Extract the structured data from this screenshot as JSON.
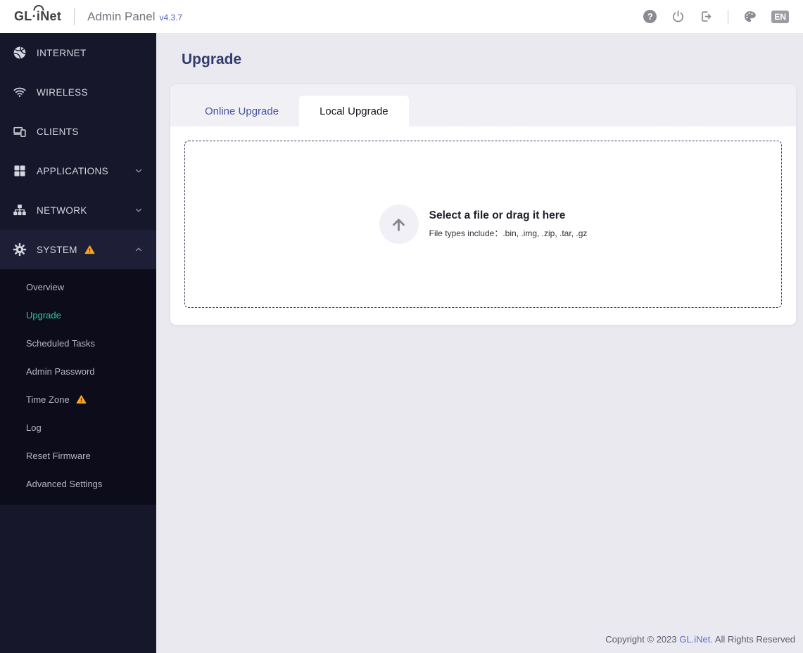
{
  "header": {
    "logo_prefix": "GL·",
    "logo_i": "i",
    "logo_suffix": "Net",
    "title": "Admin Panel",
    "version": "v4.3.7",
    "help_glyph": "?",
    "language": "EN",
    "icons": [
      "help-icon",
      "power-icon",
      "logout-icon",
      "theme-palette-icon"
    ]
  },
  "sidebar": {
    "items": [
      {
        "label": "INTERNET",
        "icon": "globe-icon"
      },
      {
        "label": "WIRELESS",
        "icon": "wifi-icon"
      },
      {
        "label": "CLIENTS",
        "icon": "devices-icon"
      },
      {
        "label": "APPLICATIONS",
        "icon": "apps-grid-icon",
        "chevron": "down"
      },
      {
        "label": "NETWORK",
        "icon": "network-icon",
        "chevron": "down"
      },
      {
        "label": "SYSTEM",
        "icon": "gear-icon",
        "chevron": "up",
        "warning": true,
        "expanded": true
      }
    ],
    "system_submenu": [
      {
        "label": "Overview",
        "active": false,
        "warning": false
      },
      {
        "label": "Upgrade",
        "active": true,
        "warning": false
      },
      {
        "label": "Scheduled Tasks",
        "active": false,
        "warning": false
      },
      {
        "label": "Admin Password",
        "active": false,
        "warning": false
      },
      {
        "label": "Time Zone",
        "active": false,
        "warning": true
      },
      {
        "label": "Log",
        "active": false,
        "warning": false
      },
      {
        "label": "Reset Firmware",
        "active": false,
        "warning": false
      },
      {
        "label": "Advanced Settings",
        "active": false,
        "warning": false
      }
    ]
  },
  "main": {
    "page_title": "Upgrade",
    "tabs": [
      {
        "label": "Online Upgrade",
        "active": false
      },
      {
        "label": "Local Upgrade",
        "active": true
      }
    ],
    "dropzone": {
      "title": "Select a file or drag it here",
      "subtitle": "File types include：.bin, .img, .zip, .tar, .gz"
    }
  },
  "footer": {
    "copyright_prefix": "Copyright © 2023 ",
    "link_text": "GL.iNet.",
    "copyright_suffix": " All Rights Reserved"
  },
  "colors": {
    "accent_teal": "#2fc9a4",
    "warning_orange": "#f5a623",
    "sidebar_bg": "#17172b",
    "submenu_bg": "#0c0c1b",
    "main_bg": "#e9e9ef",
    "tab_text_blue": "#4653a4",
    "title_navy": "#333a6d",
    "link_blue": "#5a6ed2",
    "header_bg": "#ffffff"
  }
}
